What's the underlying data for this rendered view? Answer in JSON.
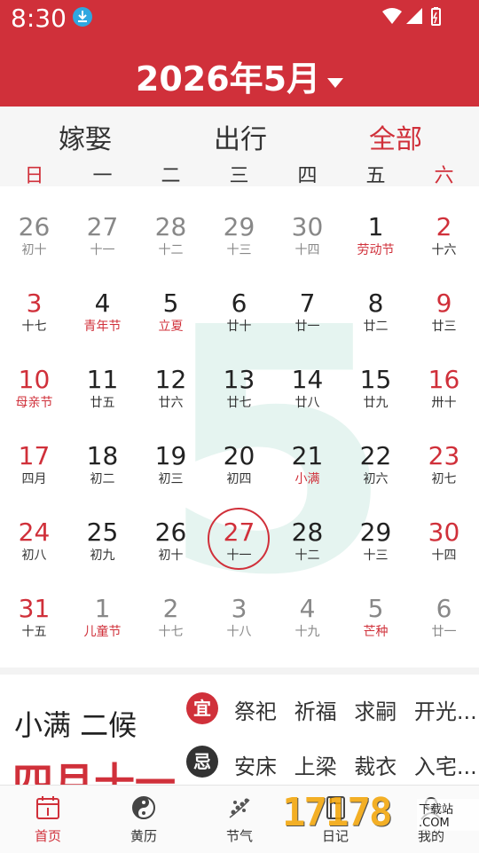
{
  "status_bar": {
    "time": "8:30"
  },
  "header": {
    "title": "2026年5月"
  },
  "filters": [
    "嫁娶",
    "出行",
    "全部"
  ],
  "weekdays": [
    "日",
    "一",
    "二",
    "三",
    "四",
    "五",
    "六"
  ],
  "calendar": {
    "big_month": "5",
    "days": [
      {
        "n": "26",
        "s": "初十",
        "other": true,
        "weekend": true
      },
      {
        "n": "27",
        "s": "十一",
        "other": true
      },
      {
        "n": "28",
        "s": "十二",
        "other": true
      },
      {
        "n": "29",
        "s": "十三",
        "other": true
      },
      {
        "n": "30",
        "s": "十四",
        "other": true
      },
      {
        "n": "1",
        "s": "劳动节",
        "fest": true
      },
      {
        "n": "2",
        "s": "十六",
        "weekend": true
      },
      {
        "n": "3",
        "s": "十七",
        "weekend": true
      },
      {
        "n": "4",
        "s": "青年节",
        "fest": true
      },
      {
        "n": "5",
        "s": "立夏",
        "fest": true
      },
      {
        "n": "6",
        "s": "廿十"
      },
      {
        "n": "7",
        "s": "廿一"
      },
      {
        "n": "8",
        "s": "廿二"
      },
      {
        "n": "9",
        "s": "廿三",
        "weekend": true
      },
      {
        "n": "10",
        "s": "母亲节",
        "weekend": true,
        "fest": true
      },
      {
        "n": "11",
        "s": "廿五"
      },
      {
        "n": "12",
        "s": "廿六"
      },
      {
        "n": "13",
        "s": "廿七"
      },
      {
        "n": "14",
        "s": "廿八"
      },
      {
        "n": "15",
        "s": "廿九"
      },
      {
        "n": "16",
        "s": "卅十",
        "weekend": true
      },
      {
        "n": "17",
        "s": "四月",
        "weekend": true
      },
      {
        "n": "18",
        "s": "初二"
      },
      {
        "n": "19",
        "s": "初三"
      },
      {
        "n": "20",
        "s": "初四"
      },
      {
        "n": "21",
        "s": "小满",
        "fest": true
      },
      {
        "n": "22",
        "s": "初六"
      },
      {
        "n": "23",
        "s": "初七",
        "weekend": true
      },
      {
        "n": "24",
        "s": "初八",
        "weekend": true
      },
      {
        "n": "25",
        "s": "初九"
      },
      {
        "n": "26",
        "s": "初十"
      },
      {
        "n": "27",
        "s": "十一",
        "today": true
      },
      {
        "n": "28",
        "s": "十二"
      },
      {
        "n": "29",
        "s": "十三"
      },
      {
        "n": "30",
        "s": "十四",
        "weekend": true
      },
      {
        "n": "31",
        "s": "十五",
        "weekend": true
      },
      {
        "n": "1",
        "s": "儿童节",
        "other": true,
        "fest": true
      },
      {
        "n": "2",
        "s": "十七",
        "other": true
      },
      {
        "n": "3",
        "s": "十八",
        "other": true
      },
      {
        "n": "4",
        "s": "十九",
        "other": true
      },
      {
        "n": "5",
        "s": "芒种",
        "other": true,
        "fest": true
      },
      {
        "n": "6",
        "s": "廿一",
        "other": true,
        "weekend": true
      }
    ]
  },
  "info": {
    "solar_term": "小满 二候",
    "lunar_date": "四月十一",
    "yi_label": "宜",
    "yi": [
      "祭祀",
      "祈福",
      "求嗣",
      "开光..."
    ],
    "ji_label": "忌",
    "ji": [
      "安床",
      "上梁",
      "裁衣",
      "入宅..."
    ]
  },
  "tabs": [
    {
      "label": "首页",
      "icon": "calendar-icon",
      "active": true
    },
    {
      "label": "黄历",
      "icon": "yin-yang-icon"
    },
    {
      "label": "节气",
      "icon": "flower-icon"
    },
    {
      "label": "日记",
      "icon": "notebook-icon"
    },
    {
      "label": "我的",
      "icon": "person-icon"
    }
  ],
  "watermark": {
    "text": "17178",
    "suffix": "下载站 .COM"
  },
  "colors": {
    "primary": "#d0303a",
    "festival": "#d0303a",
    "other_month": "#888888"
  }
}
